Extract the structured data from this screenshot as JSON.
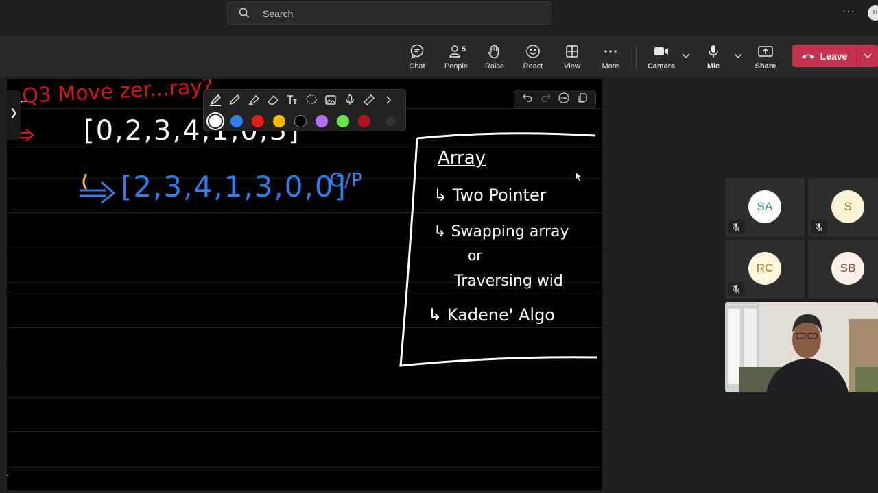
{
  "search": {
    "placeholder": "Search"
  },
  "account": {
    "initial": "B"
  },
  "toolbar": {
    "chat": "Chat",
    "people": "People",
    "people_count": "5",
    "raise": "Raise",
    "react": "React",
    "view": "View",
    "more": "More",
    "camera": "Camera",
    "mic": "Mic",
    "share": "Share",
    "leave": "Leave"
  },
  "colors": {
    "leave_red": "#c4314b",
    "ink_red": "#d4141c",
    "ink_blue": "#2f80ed",
    "ink_white": "#ffffff",
    "ink_yellow": "#f5b800"
  },
  "pen_toolbar": {
    "tools": [
      "pen-icon",
      "pencil-icon",
      "highlighter-icon",
      "eraser-icon",
      "text-icon",
      "lasso-icon",
      "image-icon",
      "mic-icon",
      "ruler-icon",
      "chevron-right-icon"
    ],
    "swatches": [
      "#ffffff",
      "#2f80ed",
      "#e01e1e",
      "#f5b800",
      "#000000",
      "#b26df0",
      "#6be14b",
      "#b3121b"
    ]
  },
  "canvas": {
    "title": "Q3 Move zer...ray?",
    "input_array": "[0,2,3,4,1,0,3]",
    "output_array": "[2,3,4,1,3,0,0]",
    "output_label": "O/P",
    "box": {
      "heading": "Array",
      "items": [
        "Two Pointer",
        "Swapping array",
        "or",
        "Traversing wid",
        "Kadene' Algo"
      ]
    }
  },
  "participants": [
    {
      "initials": "SA",
      "bg": "#ffffff",
      "fg": "#2a8c8c"
    },
    {
      "initials": "S",
      "bg": "#fbf3d5",
      "fg": "#9a7a1a"
    },
    {
      "initials": "RC",
      "bg": "#fdf6da",
      "fg": "#a08218"
    },
    {
      "initials": "SB",
      "bg": "#fbefe6",
      "fg": "#7a4a3a"
    }
  ]
}
